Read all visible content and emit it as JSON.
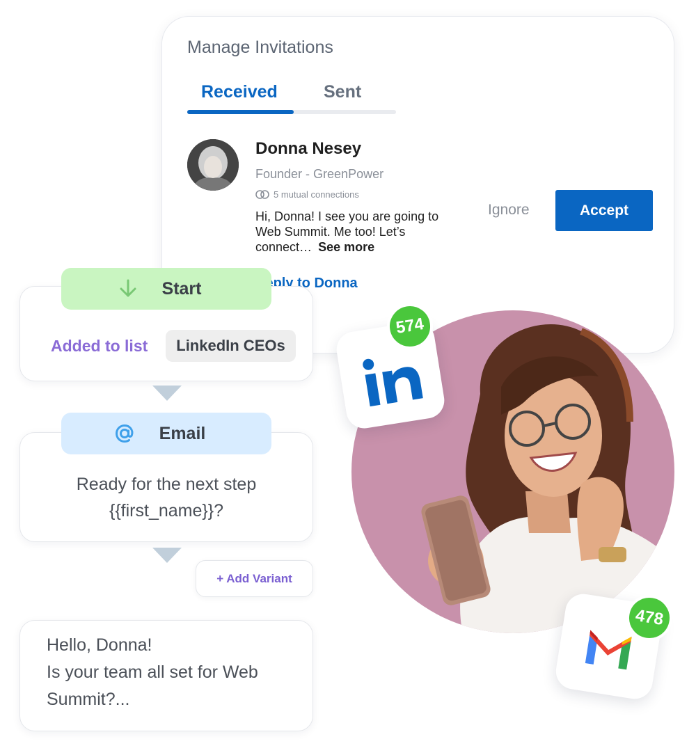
{
  "invitations": {
    "title": "Manage Invitations",
    "tabs": [
      {
        "label": "Received",
        "active": true
      },
      {
        "label": "Sent",
        "active": false
      }
    ],
    "invite": {
      "name": "Donna Nesey",
      "role": "Founder - GreenPower",
      "mutual": "5 mutual connections",
      "message": "Hi, Donna! I see you are going to Web Summit. Me too! Let’s connect…",
      "see_more": "See more",
      "reply": "Reply to Donna",
      "ignore_label": "Ignore",
      "accept_label": "Accept"
    }
  },
  "workflow": {
    "start_label": "Start",
    "added_label": "Added to list",
    "list_name": "LinkedIn CEOs",
    "email_label": "Email",
    "email_line1": "Ready for the next step",
    "email_line2": "{{first_name}}?",
    "add_variant_label": "+ Add Variant",
    "hello_lines": [
      "Hello, Donna!",
      "Is your team all set for Web",
      "Summit?..."
    ]
  },
  "badges": {
    "linkedin_count": "574",
    "gmail_count": "478"
  },
  "icons": {
    "start": "arrow-down-icon",
    "email": "at-sign-icon",
    "mutual": "mutual-connections-icon",
    "linkedin": "linkedin-logo-icon",
    "gmail": "gmail-logo-icon"
  },
  "colors": {
    "accent_blue": "#0a66c2",
    "start_green": "#c9f5c1",
    "email_blue": "#d8ecff",
    "purple_text": "#8a6bd6",
    "badge_green": "#4ac73c",
    "photo_bg": "#c891ab"
  }
}
